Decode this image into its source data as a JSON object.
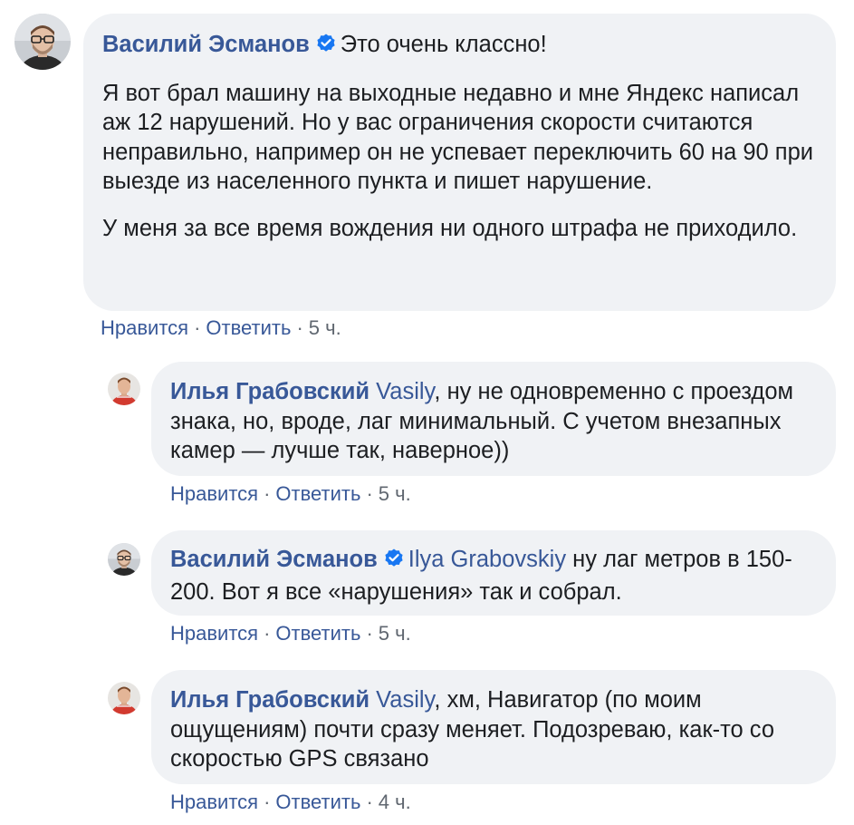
{
  "comments": [
    {
      "author": "Василий Эсманов",
      "verified": true,
      "avatar_icon": "user-avatar-glasses",
      "mention": "",
      "first_line_text": "Это очень классно!",
      "paragraphs": [
        "Я вот брал машину на выходные недавно и мне Яндекс написал аж 12 нарушений. Но у вас ограничения скорости считаются неправильно, например он не успевает переключить 60 на 90 при выезде из населенного пункта и пишет нарушение.",
        "У меня за все время вождения ни одного штрафа не приходило."
      ],
      "like_label": "Нравится",
      "reply_label": "Ответить",
      "time": "5 ч."
    },
    {
      "author": "Илья Грабовский",
      "verified": false,
      "avatar_icon": "user-avatar-red-shirt",
      "mention": "Vasily",
      "text": ", ну не одновременно с проездом знака, но, вроде, лаг минимальный. С учетом внезапных камер — лучше так, наверное))",
      "like_label": "Нравится",
      "reply_label": "Ответить",
      "time": "5 ч."
    },
    {
      "author": "Василий Эсманов",
      "verified": true,
      "avatar_icon": "user-avatar-glasses",
      "mention": "Ilya Grabovskiy",
      "text": " ну лаг метров в 150-200. Вот я все «нарушения» так и собрал.",
      "like_label": "Нравится",
      "reply_label": "Ответить",
      "time": "5 ч."
    },
    {
      "author": "Илья Грабовский",
      "verified": false,
      "avatar_icon": "user-avatar-red-shirt",
      "mention": "Vasily",
      "text": ", хм, Навигатор (по моим ощущениям) почти сразу меняет. Подозреваю, как-то со скоростью GPS связано",
      "like_label": "Нравится",
      "reply_label": "Ответить",
      "time": "4 ч."
    }
  ],
  "colors": {
    "link": "#385898",
    "bubble": "#f0f2f5",
    "meta": "#606770",
    "verified": "#1877f2"
  }
}
